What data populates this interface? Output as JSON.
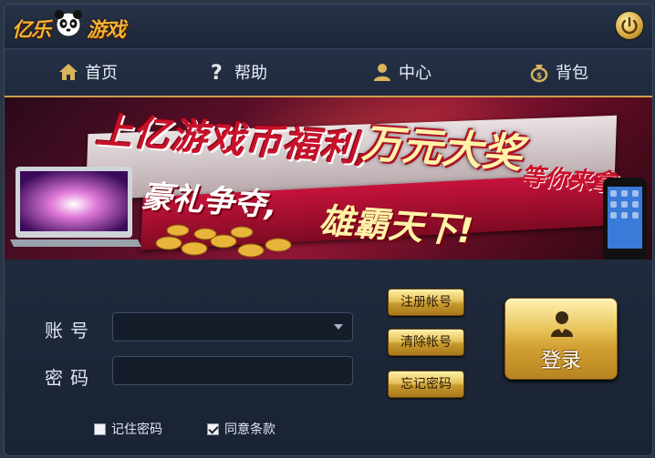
{
  "app": {
    "logo_left": "亿乐",
    "logo_right": "游戏"
  },
  "nav": {
    "items": [
      {
        "label": "首页",
        "icon": "home-icon"
      },
      {
        "label": "帮助",
        "icon": "help-icon"
      },
      {
        "label": "中心",
        "icon": "user-center-icon"
      },
      {
        "label": "背包",
        "icon": "bag-icon"
      }
    ]
  },
  "banner": {
    "line1": "上亿游戏币福利,",
    "line1_highlight": "万元大奖",
    "line1_tail": "等你来拿",
    "line2": "豪礼争夺,",
    "line2_highlight": "雄霸天下!"
  },
  "form": {
    "account_label": "账号",
    "password_label": "密码",
    "account_value": "",
    "password_value": "",
    "register_button": "注册帐号",
    "clear_button": "清除帐号",
    "forgot_button": "忘记密码",
    "login_button": "登录",
    "remember_password": {
      "label": "记住密码",
      "checked": false
    },
    "agree_terms": {
      "label": "同意条款",
      "checked": true
    }
  },
  "colors": {
    "accent_gold": "#e6c25a",
    "background": "#1c2433",
    "banner_red": "#911636"
  }
}
